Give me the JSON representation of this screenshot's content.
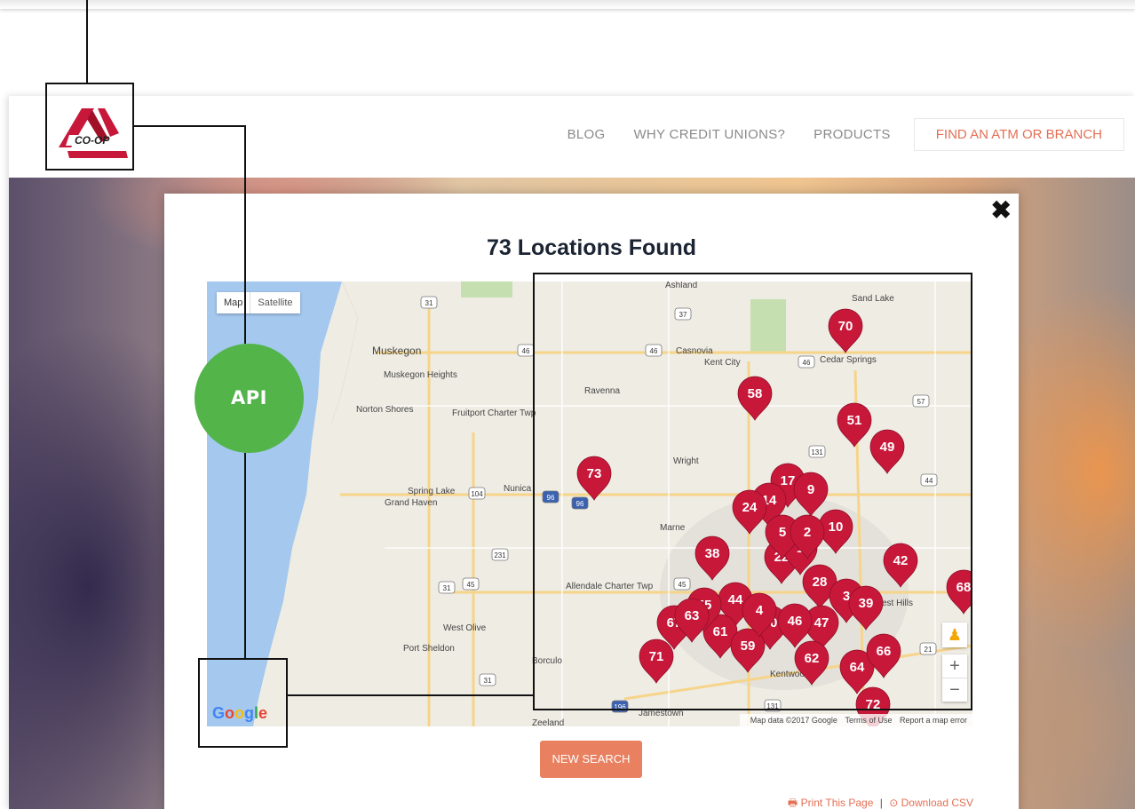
{
  "nav": {
    "items": [
      "BLOG",
      "WHY CREDIT UNIONS?",
      "PRODUCTS"
    ],
    "cta": "FIND AN ATM OR BRANCH"
  },
  "logo": {
    "text": "CO-OP"
  },
  "modal": {
    "close": "✖",
    "title": "73 Locations Found"
  },
  "map": {
    "type_map": "Map",
    "type_satellite": "Satellite",
    "pegman": "♟",
    "zoom_in": "+",
    "zoom_out": "−",
    "logo": "Google",
    "footer": {
      "data": "Map data ©2017 Google",
      "terms": "Terms of Use",
      "report": "Report a map error"
    },
    "places": [
      "Ashland",
      "Sand Lake",
      "Muskegon",
      "Muskegon Heights",
      "Norton Shores",
      "Fruitport Charter Twp",
      "Casnovia",
      "Kent City",
      "Cedar Springs",
      "Ravenna",
      "Wright",
      "Spring Lake",
      "Grand Haven",
      "Nunica",
      "Marne",
      "Allendale Charter Twp",
      "West Olive",
      "Port Sheldon",
      "Borculo",
      "Zeeland",
      "Jamestown",
      "Kentwood",
      "est Hills"
    ],
    "routes": [
      "31",
      "37",
      "46",
      "46",
      "46",
      "57",
      "131",
      "44",
      "104",
      "96",
      "96",
      "231",
      "31",
      "45",
      "45",
      "21",
      "31",
      "131",
      "196"
    ],
    "markers": [
      "70",
      "58",
      "51",
      "49",
      "73",
      "17",
      "9",
      "14",
      "24",
      "10",
      "38",
      "22",
      "1",
      "42",
      "28",
      "3",
      "39",
      "44",
      "47",
      "50",
      "46",
      "67",
      "61",
      "59",
      "71",
      "62",
      "64",
      "66",
      "68",
      "55",
      "63",
      "72",
      "5",
      "2",
      "4"
    ]
  },
  "colors": {
    "marker": "#c8183a",
    "accent": "#e46f54",
    "api": "#53b44a",
    "water": "#a4c8ee"
  },
  "buttons": {
    "new_search": "NEW SEARCH"
  },
  "links": {
    "print": "Print This Page",
    "download": "Download CSV"
  },
  "diagram": {
    "api_label": "API"
  }
}
